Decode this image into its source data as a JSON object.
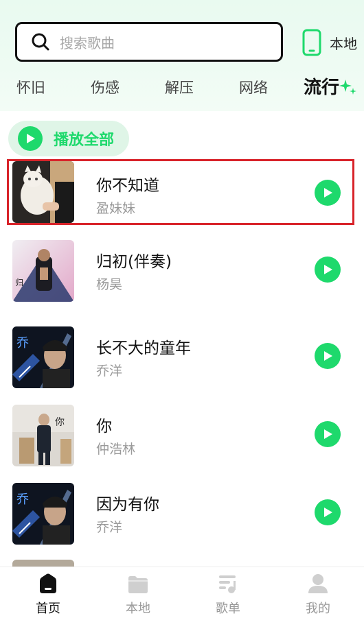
{
  "colors": {
    "accent": "#1ed96c",
    "header_bg": "#e9faf0",
    "selection_border": "#d8232a",
    "text_primary": "#111111",
    "text_secondary": "#9a9a9a"
  },
  "search": {
    "placeholder": "搜索歌曲",
    "icon": "search-icon"
  },
  "local_entry": {
    "label": "本地",
    "icon": "phone-icon"
  },
  "tabs": [
    {
      "label": "怀旧",
      "active": false
    },
    {
      "label": "伤感",
      "active": false
    },
    {
      "label": "解压",
      "active": false
    },
    {
      "label": "网络",
      "active": false
    },
    {
      "label": "流行",
      "active": true
    }
  ],
  "play_all": {
    "label": "播放全部",
    "icon": "play-icon"
  },
  "songs": [
    {
      "title": "你不知道",
      "artist": "盈妹妹",
      "selected": true
    },
    {
      "title": "归初(伴奏)",
      "artist": "杨昊",
      "selected": false
    },
    {
      "title": "长不大的童年",
      "artist": "乔洋",
      "selected": false
    },
    {
      "title": "你",
      "artist": "仲浩林",
      "selected": false
    },
    {
      "title": "因为有你",
      "artist": "乔洋",
      "selected": false
    }
  ],
  "bottom_nav": [
    {
      "label": "首页",
      "icon": "home-icon",
      "active": true
    },
    {
      "label": "本地",
      "icon": "folder-icon",
      "active": false
    },
    {
      "label": "歌单",
      "icon": "playlist-icon",
      "active": false
    },
    {
      "label": "我的",
      "icon": "user-icon",
      "active": false
    }
  ]
}
